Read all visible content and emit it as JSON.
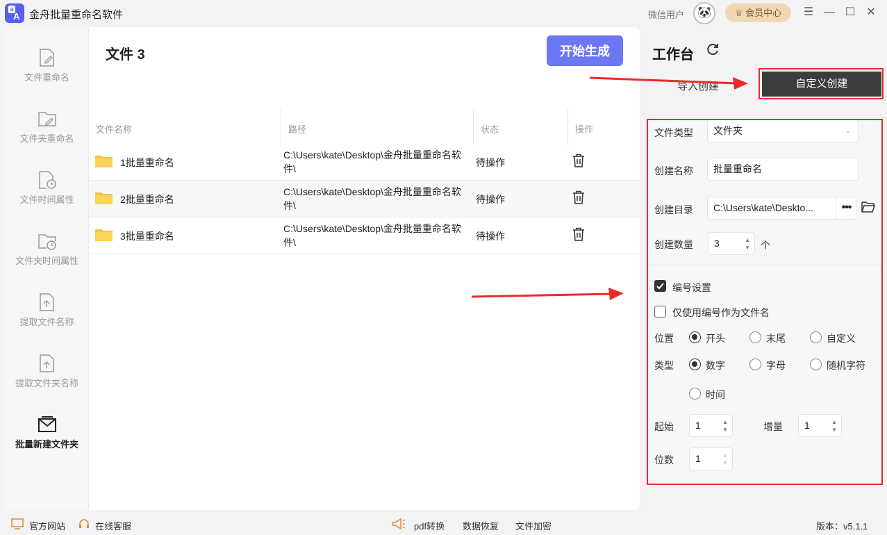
{
  "app": {
    "title": "金舟批量重命名软件",
    "user": "微信用户",
    "vip_label": "会员中心"
  },
  "sidebar": {
    "items": [
      {
        "label": "文件重命名",
        "icon": "file-edit-icon"
      },
      {
        "label": "文件夹重命名",
        "icon": "folder-edit-icon"
      },
      {
        "label": "文件时间属性",
        "icon": "file-clock-icon"
      },
      {
        "label": "文件夹时间属性",
        "icon": "folder-clock-icon"
      },
      {
        "label": "提取文件名称",
        "icon": "file-upload-icon"
      },
      {
        "label": "提取文件夹名称",
        "icon": "folder-upload-icon"
      },
      {
        "label": "批量新建文件夹",
        "icon": "new-folder-icon"
      }
    ],
    "active": 6
  },
  "files": {
    "title": "文件 3",
    "start_button": "开始生成",
    "columns": [
      "文件名称",
      "路径",
      "状态",
      "操作"
    ],
    "rows": [
      {
        "name": "1批量重命名",
        "path": "C:\\Users\\kate\\Desktop\\金舟批量重命名软件\\",
        "status": "待操作"
      },
      {
        "name": "2批量重命名",
        "path": "C:\\Users\\kate\\Desktop\\金舟批量重命名软件\\",
        "status": "待操作"
      },
      {
        "name": "3批量重命名",
        "path": "C:\\Users\\kate\\Desktop\\金舟批量重命名软件\\",
        "status": "待操作"
      }
    ]
  },
  "workbench": {
    "title": "工作台",
    "tabs": {
      "import": "导入创建",
      "custom": "自定义创建"
    },
    "file_type": {
      "label": "文件类型",
      "value": "文件夹"
    },
    "create_name": {
      "label": "创建名称",
      "value": "批量重命名"
    },
    "create_dir": {
      "label": "创建目录",
      "value": "C:\\Users\\kate\\Deskto..."
    },
    "create_count": {
      "label": "创建数量",
      "value": "3",
      "unit": "个"
    },
    "numbering": {
      "label": "编号设置",
      "checked": true
    },
    "only_number": {
      "label": "仅使用编号作为文件名",
      "checked": false
    },
    "position": {
      "label": "位置",
      "options": [
        "开头",
        "末尾",
        "自定义"
      ],
      "selected": 0
    },
    "type": {
      "label": "类型",
      "options": [
        "数字",
        "字母",
        "随机字符",
        "时间"
      ],
      "selected": 0
    },
    "start": {
      "label": "起始",
      "value": "1"
    },
    "increment": {
      "label": "增量",
      "value": "1"
    },
    "digits": {
      "label": "位数",
      "value": "1"
    }
  },
  "footer": {
    "website": "官方网站",
    "support": "在线客服",
    "pdf": "pdf转换",
    "recovery": "数据恢复",
    "encrypt": "文件加密",
    "version": "版本：v5.1.1"
  },
  "colors": {
    "accent": "#6b77f3",
    "annotation": "#e82b2b",
    "dark_tab": "#3c3c3c",
    "vip": "#f1d8b5"
  }
}
